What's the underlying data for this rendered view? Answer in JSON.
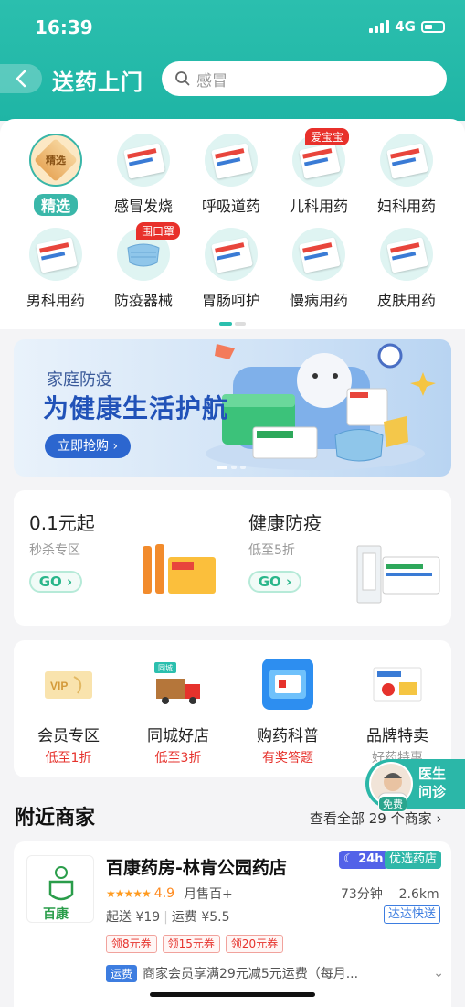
{
  "status_bar": {
    "time": "16:39",
    "network": "4G"
  },
  "header": {
    "title": "送药上门",
    "search_placeholder": "感冒"
  },
  "categories": [
    {
      "label": "精选",
      "selected": true
    },
    {
      "label": "感冒发烧"
    },
    {
      "label": "呼吸道药"
    },
    {
      "label": "儿科用药",
      "badge": "爱宝宝"
    },
    {
      "label": "妇科用药"
    },
    {
      "label": "男科用药"
    },
    {
      "label": "防疫器械",
      "badge": "围口罩"
    },
    {
      "label": "胃肠呵护"
    },
    {
      "label": "慢病用药"
    },
    {
      "label": "皮肤用药"
    }
  ],
  "banner": {
    "subtitle": "家庭防疫",
    "title": "为健康生活护航",
    "button": "立即抢购"
  },
  "promos": [
    {
      "title": "0.1元起",
      "sub": "秒杀专区",
      "button": "GO"
    },
    {
      "title": "健康防疫",
      "sub": "低至5折",
      "button": "GO"
    }
  ],
  "services": [
    {
      "label": "会员专区",
      "sub": "低至1折",
      "icon": "vip-icon"
    },
    {
      "label": "同城好店",
      "sub": "低至3折",
      "icon": "delivery-truck-icon",
      "badge": "同城"
    },
    {
      "label": "购药科普",
      "sub": "有奖答题",
      "icon": "medicine-science-icon"
    },
    {
      "label": "品牌特卖",
      "sub": "好药特惠",
      "icon": "brand-sale-icon"
    }
  ],
  "doctor_float": {
    "label": "医生问诊",
    "tag": "免费"
  },
  "nearby": {
    "title": "附近商家",
    "view_all": "查看全部 29 个商家"
  },
  "store": {
    "name": "百康药房-林肯公园药店",
    "logo_text": "百康",
    "tag_24h": "24h",
    "tag_quality": "优选药店",
    "rating": "4.9",
    "monthly_sales": "月售百+",
    "time": "73分钟",
    "distance": "2.6km",
    "min_order": "起送 ¥19",
    "delivery_fee": "运费 ¥5.5",
    "express_tag": "达达快送",
    "coupons": [
      "领8元券",
      "领15元券",
      "领20元券"
    ],
    "shipping_tag": "运费",
    "shipping_text": "商家会员享满29元减5元运费（每月..."
  },
  "colors": {
    "brand": "#2bbfae",
    "accent_red": "#e6322c",
    "blue": "#2c66cf"
  }
}
